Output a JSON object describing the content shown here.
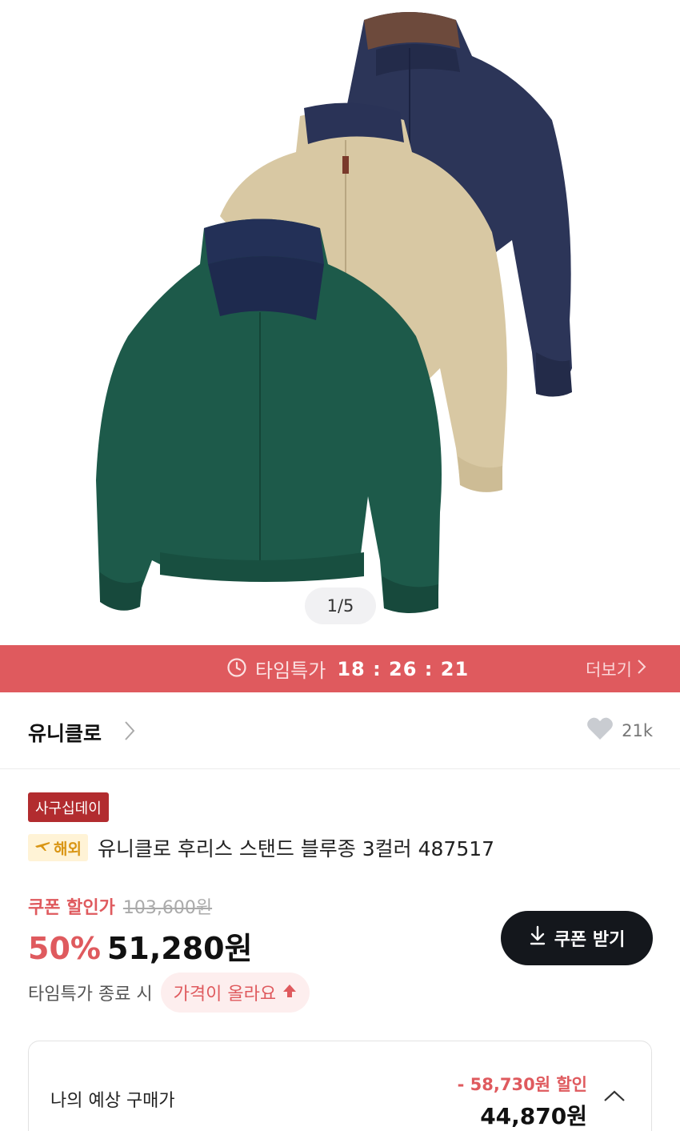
{
  "gallery": {
    "counter": "1/5"
  },
  "time_deal": {
    "label": "타임특가",
    "timer": "18 : 26 : 21",
    "more": "더보기"
  },
  "brand": {
    "name": "유니클로",
    "likes": "21k"
  },
  "product": {
    "event_tag": "사구십데이",
    "overseas_tag": "해외",
    "title": "유니클로 후리스 스탠드 블루종 3컬러 487517"
  },
  "price": {
    "coupon_label": "쿠폰 할인가",
    "original": "103,600원",
    "discount_rate": "50%",
    "final": "51,280원",
    "coupon_button": "쿠폰 받기",
    "deal_end_text": "타임특가 종료 시",
    "price_up_text": "가격이 올라요"
  },
  "estimate": {
    "label": "나의 예상 구매가",
    "discount": "- 58,730원 할인",
    "price": "44,870원"
  },
  "colors": {
    "accent": "#df5a5e",
    "deal_bar": "#df5a5e",
    "dark_button": "#14171c"
  }
}
